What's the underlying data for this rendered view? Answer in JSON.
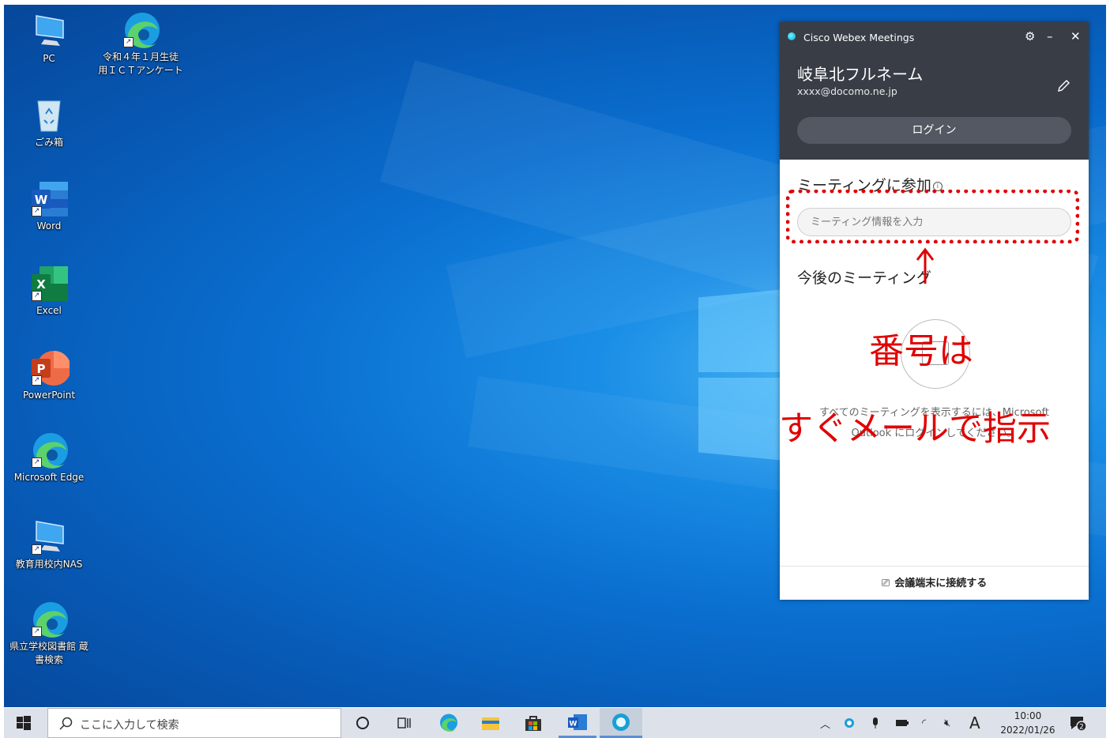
{
  "desktop": {
    "icons": [
      {
        "label": "PC",
        "icon": "pc-icon"
      },
      {
        "label": "令和４年１月生徒用ＩＣＴアンケート",
        "label_l1": "令和４年１月生徒",
        "label_l2": "用ＩＣＴアンケート",
        "icon": "edge-icon"
      },
      {
        "label": "ごみ箱",
        "icon": "recycle-bin-icon"
      },
      {
        "label": "Word",
        "icon": "word-icon"
      },
      {
        "label": "Excel",
        "icon": "excel-icon"
      },
      {
        "label": "PowerPoint",
        "icon": "powerpoint-icon"
      },
      {
        "label": "Microsoft Edge",
        "icon": "edge-icon"
      },
      {
        "label": "教育用校内NAS",
        "icon": "network-pc-icon"
      },
      {
        "label": "県立学校図書館 蔵書検索",
        "label_l1": "県立学校図書館 蔵",
        "label_l2": "書検索",
        "icon": "edge-icon"
      }
    ]
  },
  "webex": {
    "title": "Cisco Webex Meetings",
    "user_name": "岐阜北フルネーム",
    "email": "xxxx@docomo.ne.jp",
    "login_label": "ログイン",
    "join_section_title": "ミーティングに参加",
    "join_input_placeholder": "ミーティング情報を入力",
    "upcoming_title": "今後のミーティング",
    "empty_line1": "すべてのミーティングを表示するには、Microsoft",
    "empty_line2": "Outlook にログインしてください。",
    "connect_label": "会議端末に接続する"
  },
  "annotation": {
    "line1": "番号は",
    "line2": "すぐメールで指示",
    "color": "#e00000"
  },
  "taskbar": {
    "search_placeholder": "ここに入力して検索",
    "ime_indicator": "A",
    "time": "10:00",
    "date": "2022/01/26",
    "notification_count": "2"
  }
}
